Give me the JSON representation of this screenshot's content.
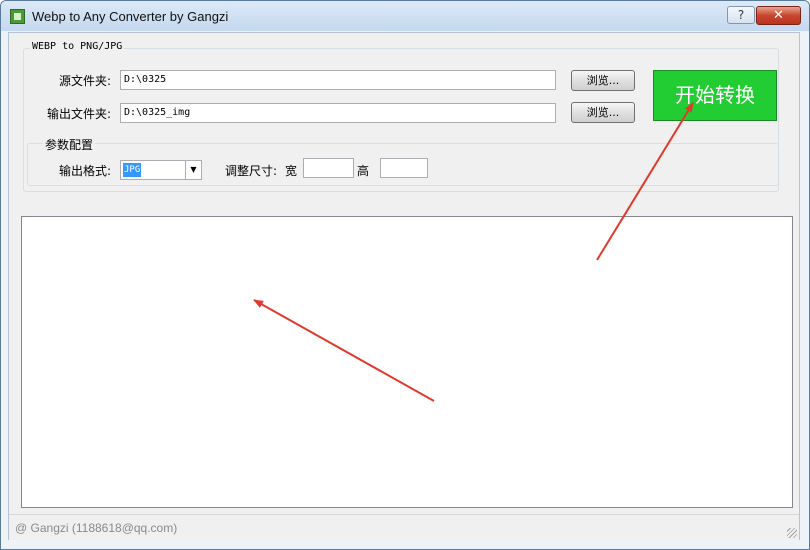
{
  "window": {
    "title": "Webp to Any Converter by Gangzi",
    "help_glyph": "?",
    "close_glyph": "✕"
  },
  "main_group": {
    "legend": "WEBP to PNG/JPG",
    "source_label": "源文件夹:",
    "source_value": "D:\\0325",
    "output_label": "输出文件夹:",
    "output_value": "D:\\0325_img",
    "browse_label": "浏览...",
    "start_label": "开始转换"
  },
  "params": {
    "legend": "参数配置",
    "format_label": "输出格式:",
    "format_value": "JPG",
    "resize_label": "调整尺寸:",
    "width_label": "宽",
    "width_value": "",
    "height_label": "高",
    "height_value": ""
  },
  "log": {
    "content": ""
  },
  "status": {
    "text": "@ Gangzi (1188618@qq.com)"
  },
  "colors": {
    "start_button": "#22cc33",
    "annotation_arrow": "#e03a2e"
  },
  "icons": [
    "app-icon",
    "help-icon",
    "close-icon",
    "chevron-down-icon",
    "resize-grip-icon"
  ]
}
